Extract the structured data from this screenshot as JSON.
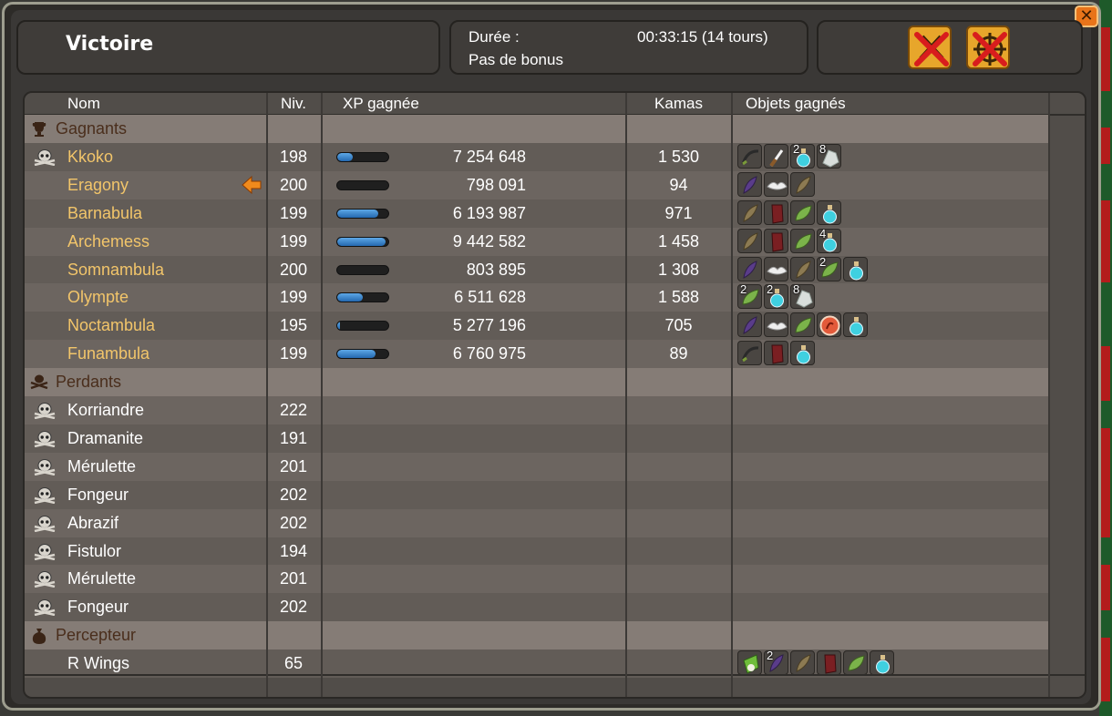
{
  "window": {
    "close_glyph": "✕",
    "result_title": "Victoire",
    "duration_label": "Durée :",
    "duration_value": "00:33:15 (14 tours)",
    "bonus_text": "Pas de bonus"
  },
  "columns": {
    "name": "Nom",
    "level": "Niv.",
    "xp": "XP gagnée",
    "kamas": "Kamas",
    "items": "Objets gagnés"
  },
  "sections": {
    "winners": "Gagnants",
    "losers": "Perdants",
    "collector": "Percepteur"
  },
  "winners": [
    {
      "name": "Kkoko",
      "level": "198",
      "xp": "7 254 648",
      "kamas": "1 530",
      "xp_progress": 0.3,
      "skull": true,
      "turn_arrow": false,
      "items": [
        {
          "icon": "whip-icon"
        },
        {
          "icon": "quill-icon"
        },
        {
          "icon": "potion-icon",
          "qty": "2"
        },
        {
          "icon": "crystal-icon",
          "qty": "8"
        }
      ]
    },
    {
      "name": "Eragony",
      "level": "200",
      "xp": "798 091",
      "kamas": "94",
      "xp_progress": 0.0,
      "skull": false,
      "turn_arrow": true,
      "items": [
        {
          "icon": "purple-feather-icon"
        },
        {
          "icon": "white-wing-icon"
        },
        {
          "icon": "brown-feather-icon"
        }
      ]
    },
    {
      "name": "Barnabula",
      "level": "199",
      "xp": "6 193 987",
      "kamas": "971",
      "xp_progress": 0.8,
      "skull": false,
      "turn_arrow": false,
      "items": [
        {
          "icon": "brown-feather-icon"
        },
        {
          "icon": "red-cloth-icon"
        },
        {
          "icon": "leaf-icon"
        },
        {
          "icon": "potion-icon"
        }
      ]
    },
    {
      "name": "Archemess",
      "level": "199",
      "xp": "9 442 582",
      "kamas": "1 458",
      "xp_progress": 0.95,
      "skull": false,
      "turn_arrow": false,
      "items": [
        {
          "icon": "brown-feather-icon"
        },
        {
          "icon": "red-cloth-icon"
        },
        {
          "icon": "leaf-icon"
        },
        {
          "icon": "potion-icon",
          "qty": "4"
        }
      ]
    },
    {
      "name": "Somnambula",
      "level": "200",
      "xp": "803 895",
      "kamas": "1 308",
      "xp_progress": 0.0,
      "skull": false,
      "turn_arrow": false,
      "items": [
        {
          "icon": "purple-feather-icon"
        },
        {
          "icon": "white-wing-icon"
        },
        {
          "icon": "brown-feather-icon"
        },
        {
          "icon": "leaf-icon",
          "qty": "2"
        },
        {
          "icon": "potion-icon"
        }
      ]
    },
    {
      "name": "Olympte",
      "level": "199",
      "xp": "6 511 628",
      "kamas": "1 588",
      "xp_progress": 0.5,
      "skull": false,
      "turn_arrow": false,
      "items": [
        {
          "icon": "leaf-icon",
          "qty": "2"
        },
        {
          "icon": "potion-icon",
          "qty": "2"
        },
        {
          "icon": "crystal-icon",
          "qty": "8"
        }
      ]
    },
    {
      "name": "Noctambula",
      "level": "195",
      "xp": "5 277 196",
      "kamas": "705",
      "xp_progress": 0.05,
      "skull": false,
      "turn_arrow": false,
      "items": [
        {
          "icon": "purple-feather-icon"
        },
        {
          "icon": "white-wing-icon"
        },
        {
          "icon": "leaf-icon"
        },
        {
          "icon": "red-orb-icon"
        },
        {
          "icon": "potion-icon"
        }
      ]
    },
    {
      "name": "Funambula",
      "level": "199",
      "xp": "6 760 975",
      "kamas": "89",
      "xp_progress": 0.75,
      "skull": false,
      "turn_arrow": false,
      "items": [
        {
          "icon": "whip-icon"
        },
        {
          "icon": "red-cloth-icon"
        },
        {
          "icon": "potion-icon"
        }
      ]
    }
  ],
  "losers": [
    {
      "name": "Korriandre",
      "level": "222"
    },
    {
      "name": "Dramanite",
      "level": "191"
    },
    {
      "name": "Mérulette",
      "level": "201"
    },
    {
      "name": "Fongeur",
      "level": "202"
    },
    {
      "name": "Abrazif",
      "level": "202"
    },
    {
      "name": "Fistulor",
      "level": "194"
    },
    {
      "name": "Mérulette",
      "level": "201"
    },
    {
      "name": "Fongeur",
      "level": "202"
    }
  ],
  "collector": [
    {
      "name": "R Wings",
      "level": "65",
      "items": [
        {
          "icon": "green-bag-icon"
        },
        {
          "icon": "purple-feather-icon",
          "qty": "2"
        },
        {
          "icon": "brown-feather-icon"
        },
        {
          "icon": "red-cloth-icon"
        },
        {
          "icon": "leaf-icon"
        },
        {
          "icon": "potion-icon"
        }
      ]
    }
  ],
  "colors": {
    "winner_name": "#f2c56a",
    "loser_name": "#ffffff",
    "section_label": "#4a2e1c",
    "xp_bar_fill": "#2f78c4",
    "action_icon_bg": "#e7a62b"
  }
}
